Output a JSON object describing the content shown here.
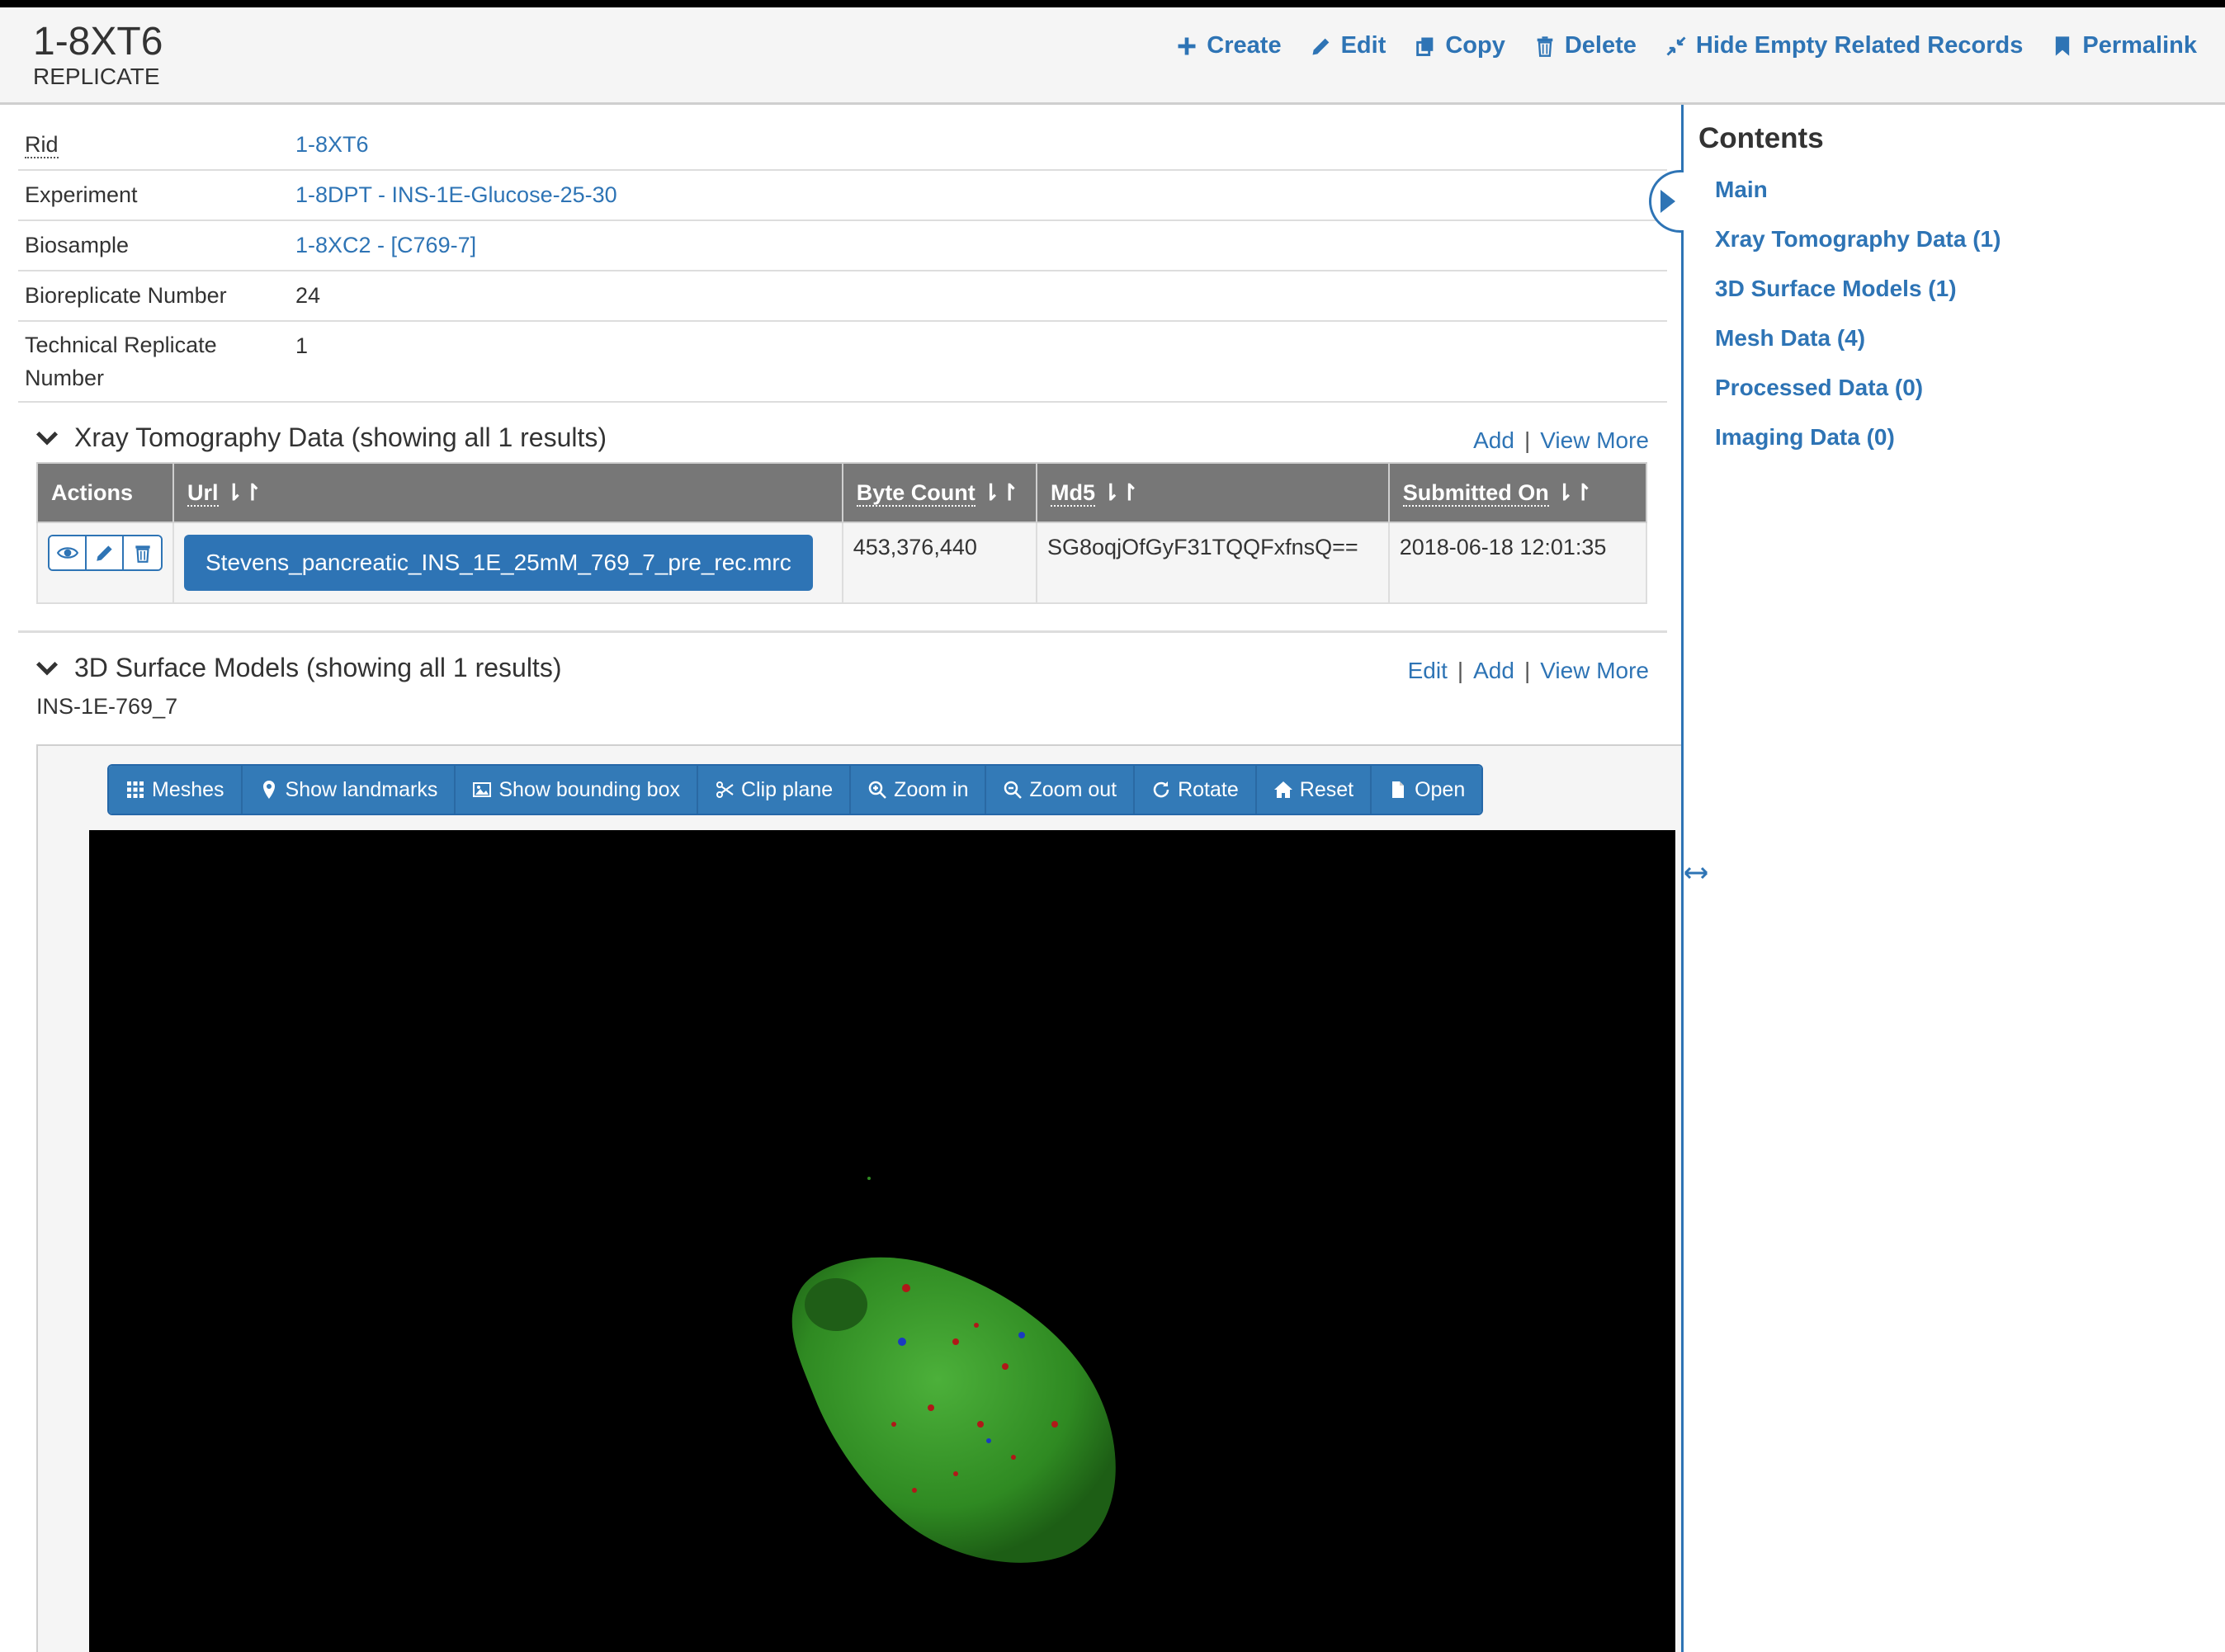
{
  "header": {
    "rid": "1-8XT6",
    "table_name": "REPLICATE",
    "actions": [
      "Create",
      "Edit",
      "Copy",
      "Delete",
      "Hide Empty Related Records",
      "Permalink"
    ]
  },
  "record": [
    {
      "key": "Rid",
      "value": "1-8XT6"
    },
    {
      "key": "Experiment",
      "value": "1-8DPT - INS-1E-Glucose-25-30"
    },
    {
      "key": "Biosample",
      "value": "1-8XC2 - [C769-7]"
    },
    {
      "key": "Bioreplicate Number",
      "value": "24"
    },
    {
      "key": "Technical Replicate Number",
      "value": "1"
    }
  ],
  "xray": {
    "title": "Xray Tomography Data (showing all 1 results)",
    "links": {
      "add": "Add",
      "view_more": "View More"
    },
    "columns": [
      "Actions",
      "Url",
      "Byte Count",
      "Md5",
      "Submitted On"
    ],
    "row": {
      "url": "Stevens_pancreatic_INS_1E_25mM_769_7_pre_rec.mrc",
      "byte_count": "453,376,440",
      "md5": "SG8oqjOfGyF31TQQFxfnsQ==",
      "submitted_on": "2018-06-18 12:01:35"
    }
  },
  "surface": {
    "title": "3D Surface Models (showing all 1 results)",
    "links": {
      "edit": "Edit",
      "add": "Add",
      "view_more": "View More"
    },
    "model_name": "INS-1E-769_7",
    "toolbar": [
      "Meshes",
      "Show landmarks",
      "Show bounding box",
      "Clip plane",
      "Zoom in",
      "Zoom out",
      "Rotate",
      "Reset",
      "Open"
    ]
  },
  "toc": {
    "title": "Contents",
    "items": [
      "Main",
      "Xray Tomography Data (1)",
      "3D Surface Models (1)",
      "Mesh Data (4)",
      "Processed Data (0)",
      "Imaging Data (0)"
    ]
  },
  "colors": {
    "link": "#2e74b5",
    "header_bg": "#f5f5f5",
    "table_head": "#777777",
    "button": "#337ab7",
    "cell_green": "#3a9a2a"
  },
  "icons": [
    "plus-icon",
    "pencil-icon",
    "copy-icon",
    "trash-icon",
    "compress-icon",
    "bookmark-icon",
    "chevron-down-icon",
    "sort-icon",
    "eye-icon",
    "grid-icon",
    "map-marker-icon",
    "picture-icon",
    "scissors-icon",
    "zoom-in-icon",
    "zoom-out-icon",
    "refresh-icon",
    "home-icon",
    "file-icon",
    "caret-right-icon",
    "resize-horizontal-icon"
  ]
}
